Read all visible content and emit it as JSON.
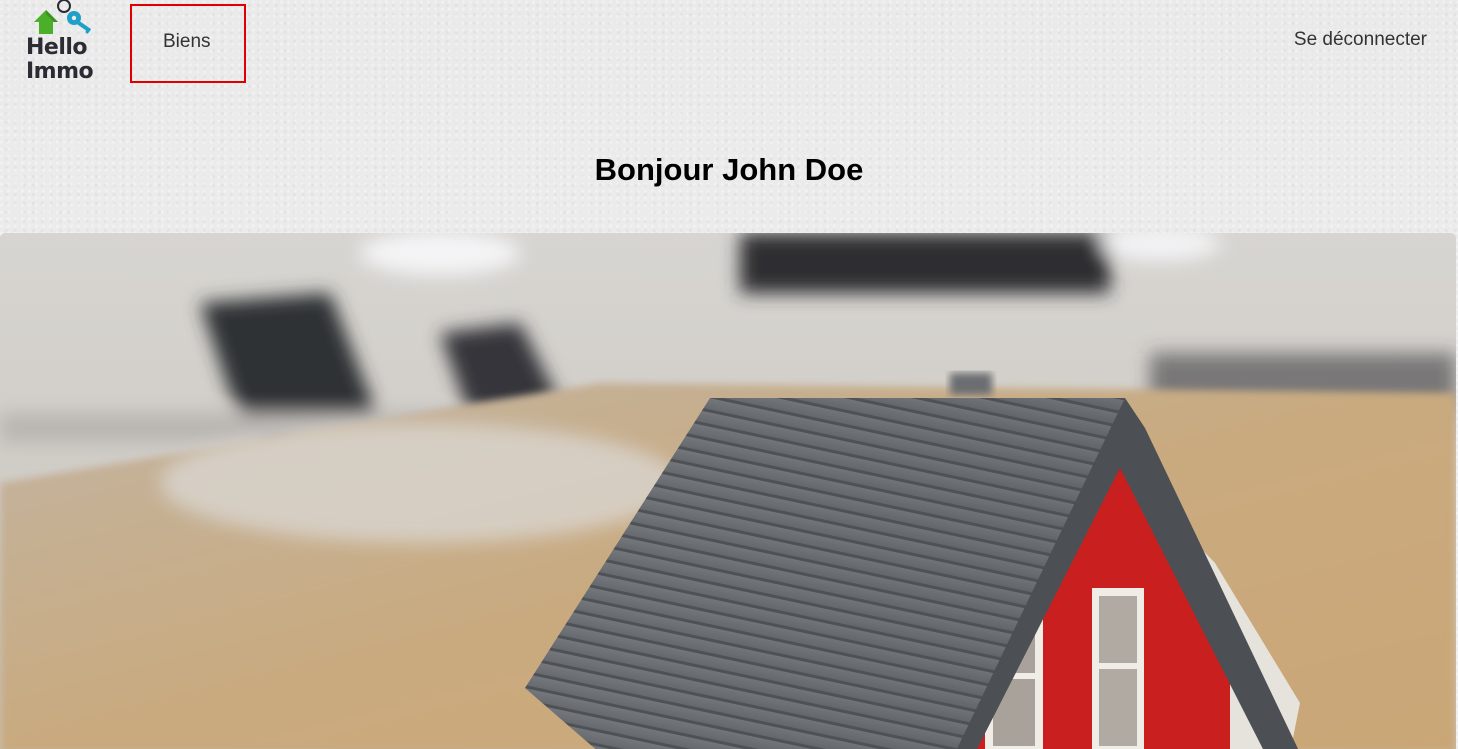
{
  "header": {
    "logo": {
      "line1": "Hello",
      "line2": "Immo",
      "icons": [
        "house-arrow-icon",
        "key-icon"
      ],
      "colors": {
        "house": "#4caf2a",
        "key": "#1ea0c8",
        "text": "#2b2b33"
      }
    },
    "nav": {
      "biens_label": "Biens",
      "highlight_color": "#e00000"
    },
    "logout_label": "Se déconnecter"
  },
  "main": {
    "greeting": "Bonjour John Doe",
    "hero_image": "model-house-photo"
  }
}
